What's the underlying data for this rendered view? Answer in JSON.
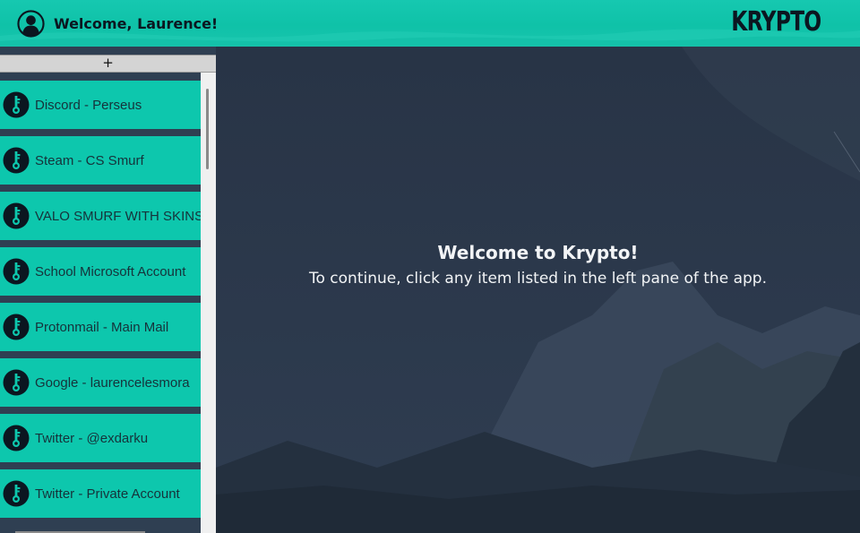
{
  "header": {
    "welcome": "Welcome, Laurence!",
    "logo": "KRYPTO",
    "accent": "#0dc7ad"
  },
  "sidebar": {
    "add_label": "+",
    "items": [
      {
        "label": "Discord - Perseus",
        "icon": "key-icon"
      },
      {
        "label": "Steam - CS Smurf",
        "icon": "key-icon"
      },
      {
        "label": "VALO SMURF WITH SKINS",
        "icon": "key-icon"
      },
      {
        "label": "School Microsoft Account",
        "icon": "key-icon"
      },
      {
        "label": "Protonmail - Main Mail",
        "icon": "key-icon"
      },
      {
        "label": "Google - laurencelesmora",
        "icon": "key-icon"
      },
      {
        "label": "Twitter - @exdarku",
        "icon": "key-icon"
      },
      {
        "label": "Twitter - Private Account",
        "icon": "key-icon"
      }
    ]
  },
  "main": {
    "title": "Welcome to Krypto!",
    "subtitle": "To continue, click any item listed in the left pane of the app."
  }
}
